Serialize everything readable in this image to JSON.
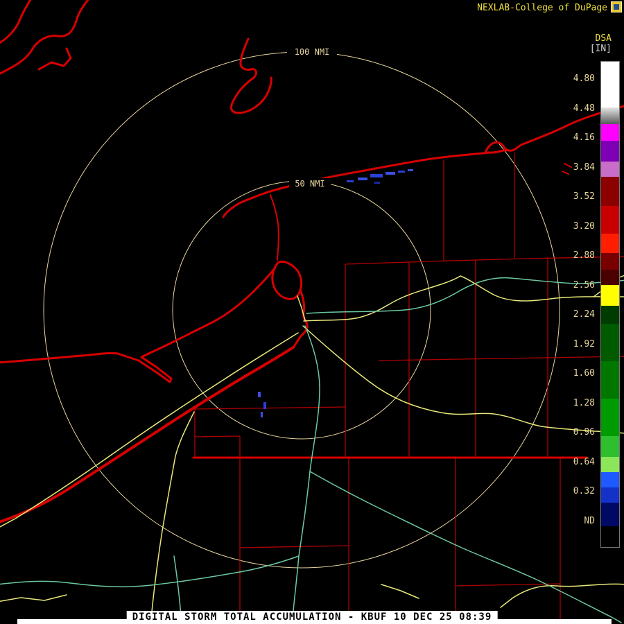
{
  "header": {
    "brand": "NEXLAB-College of DuPage",
    "logo": "cod-flag-logo",
    "product_code": "DSA",
    "units": "[IN]"
  },
  "map": {
    "range_rings": {
      "outer_label": "100 NMI",
      "inner_label": "50 NMI"
    }
  },
  "legend": {
    "labels": [
      "4.80",
      "4.48",
      "4.16",
      "3.84",
      "3.52",
      "3.20",
      "2.88",
      "2.56",
      "2.24",
      "1.92",
      "1.60",
      "1.28",
      "0.96",
      "0.64",
      "0.32",
      "ND"
    ],
    "segments": [
      {
        "c": "#ffffff",
        "h": 66
      },
      {
        "c": "linear-gradient(180deg,#e6e6e6,#5a5a5a)",
        "h": 24
      },
      {
        "c": "#ff00ff",
        "h": 24
      },
      {
        "c": "#7d00b4",
        "h": 30
      },
      {
        "c": "#c86ec8",
        "h": 22
      },
      {
        "c": "#8c0000",
        "h": 42
      },
      {
        "c": "#c80000",
        "h": 40
      },
      {
        "c": "#ff1e00",
        "h": 28
      },
      {
        "c": "#780000",
        "h": 24
      },
      {
        "c": "#4b0000",
        "h": 22
      },
      {
        "c": "#ffff00",
        "h": 30
      },
      {
        "c": "#003c00",
        "h": 26
      },
      {
        "c": "#005a00",
        "h": 54
      },
      {
        "c": "#007800",
        "h": 54
      },
      {
        "c": "#009b00",
        "h": 54
      },
      {
        "c": "#2ebe2e",
        "h": 30
      },
      {
        "c": "#8ce65a",
        "h": 22
      },
      {
        "c": "#1e5aff",
        "h": 22
      },
      {
        "c": "#1432c8",
        "h": 22
      },
      {
        "c": "#000a64",
        "h": 34
      },
      {
        "c": "#000000",
        "h": 30
      }
    ]
  },
  "colors": {
    "background": "#000000",
    "brand_text": "#f0e23c",
    "units_text": "#d8d8d8",
    "legend_label": "#e9d69e",
    "range_ring": "#e9d69e",
    "state_line": "#d80000",
    "county_line": "#b00000",
    "road_primary": "#e8e878",
    "road_secondary": "#6cc9a0",
    "echo_blue": "#3a4fe0",
    "footer_bar": "#ffffff",
    "footer_text": "#000000"
  },
  "footer": {
    "title": "DIGITAL STORM TOTAL ACCUMULATION - KBUF 10 DEC 25 08:39"
  }
}
